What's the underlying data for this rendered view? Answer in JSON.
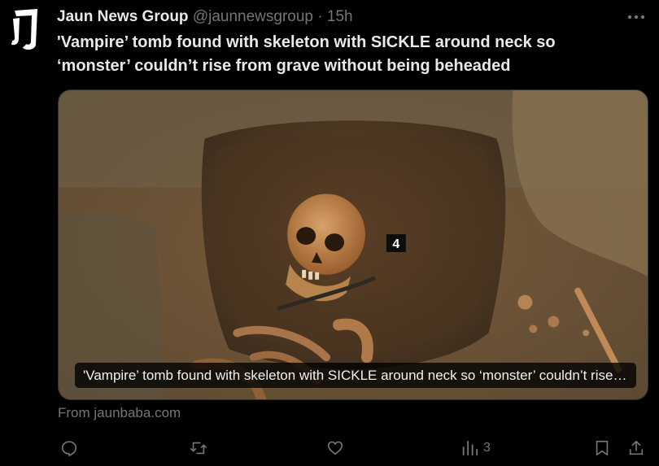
{
  "tweet": {
    "author_name": "Jaun News Group",
    "handle": "@jaunnewsgroup",
    "separator": "·",
    "time": "15h",
    "text": "'Vampire’ tomb found with skeleton with SICKLE around neck so ‘monster’ couldn’t rise from grave without being beheaded"
  },
  "card": {
    "caption": "'Vampire’ tomb found with skeleton with SICKLE around neck so ‘monster’ couldn’t rise from grave without being beheaded",
    "marker_label": "4",
    "source": "From jaunbaba.com"
  },
  "actions": {
    "views_count": "3"
  },
  "icons": {
    "avatar": "jaun-logo-icon",
    "more": "more-horizontal-icon",
    "reply": "reply-icon",
    "retweet": "retweet-icon",
    "like": "heart-icon",
    "views": "views-icon",
    "bookmark": "bookmark-icon",
    "share": "share-icon"
  }
}
